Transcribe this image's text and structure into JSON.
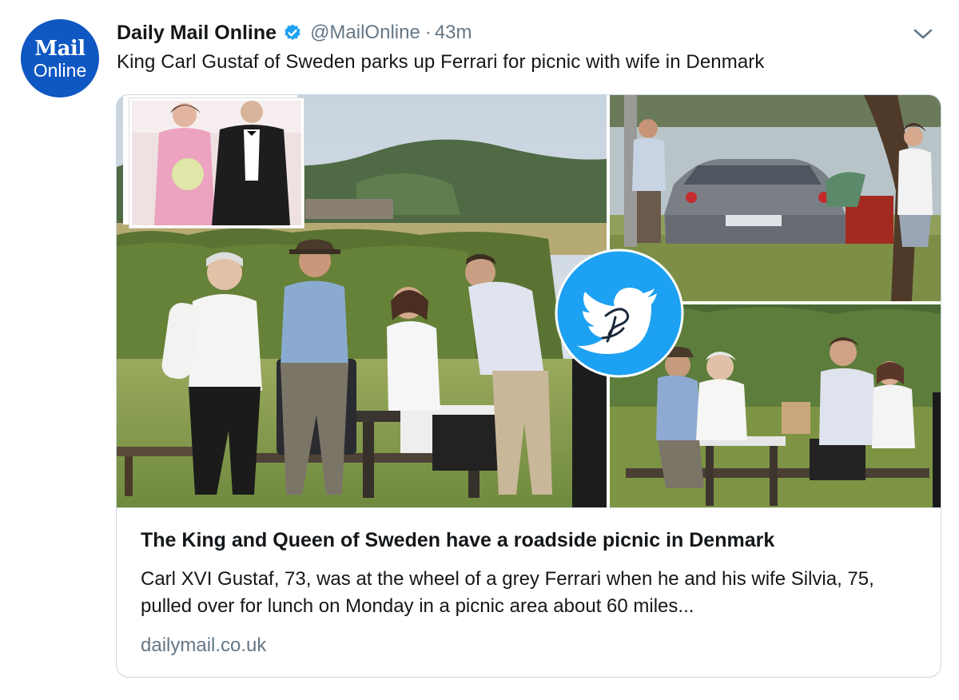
{
  "account": {
    "avatar_line1": "Mail",
    "avatar_line2": "Online",
    "name": "Daily Mail Online",
    "handle": "@MailOnline",
    "separator": "·",
    "time": "43m",
    "verified": true
  },
  "tweet": {
    "text": "King Carl Gustaf of Sweden parks up Ferrari for picnic with wife in Denmark"
  },
  "card": {
    "title": "The King and Queen of Sweden have a roadside picnic in Denmark",
    "description": "Carl XVI Gustaf, 73, was at the wheel of a grey Ferrari when he and his wife Silvia, 75, pulled over for lunch on Monday in a picnic area about 60 miles...",
    "domain": "dailymail.co.uk"
  },
  "icons": {
    "verified": "verified-badge-icon",
    "menu": "chevron-down-icon",
    "watermark": "twitter-bird-watermark-icon"
  },
  "colors": {
    "brand_blue": "#0f57c2",
    "twitter_blue": "#1da1f2",
    "text_primary": "#14171a",
    "text_secondary": "#657786",
    "border": "#ccd6dd"
  }
}
